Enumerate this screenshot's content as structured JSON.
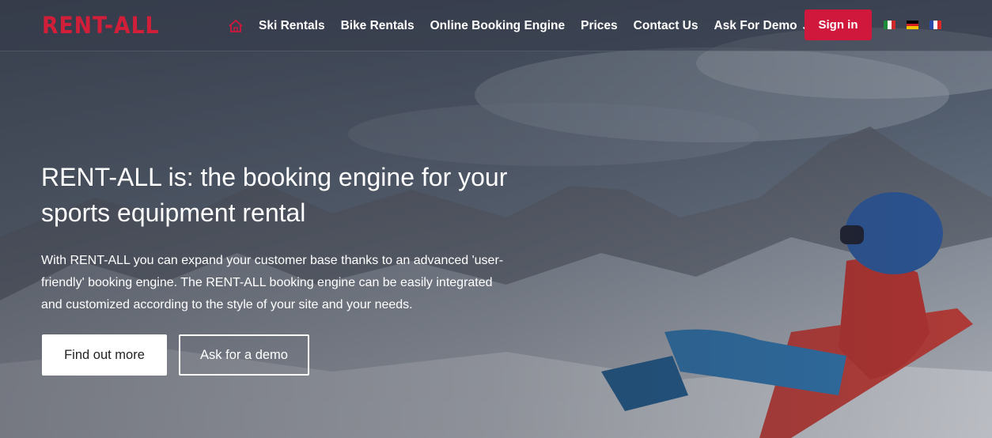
{
  "header": {
    "logo_text": "RENT-ALL",
    "nav": {
      "home_icon": "home-icon",
      "items": [
        {
          "label": "Ski Rentals"
        },
        {
          "label": "Bike Rentals"
        },
        {
          "label": "Online Booking Engine"
        },
        {
          "label": "Prices"
        },
        {
          "label": "Contact Us"
        },
        {
          "label": "Ask For Demo",
          "dropdown": true
        }
      ]
    },
    "signin_label": "Sign in",
    "languages": [
      "it",
      "de",
      "fr"
    ]
  },
  "hero": {
    "title": "RENT-ALL is: the booking engine for your sports equipment rental",
    "text": "With RENT-ALL you can expand your customer base thanks to an advanced 'user-friendly' booking engine. The RENT-ALL booking engine can be easily integrated and customized according to the style of your site and your needs.",
    "primary_button": "Find out more",
    "secondary_button": "Ask for a demo"
  },
  "colors": {
    "brand_red": "#d0183c",
    "text_white": "#ffffff"
  }
}
